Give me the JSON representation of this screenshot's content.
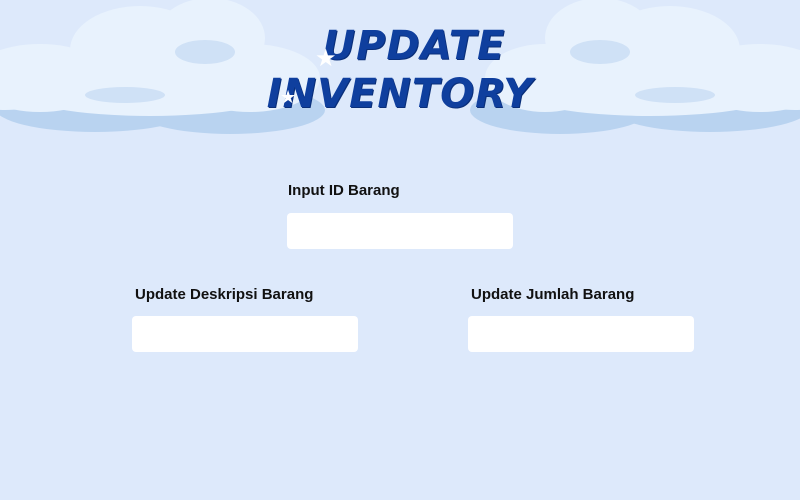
{
  "header": {
    "title_line1": "UPDATE",
    "title_line2": "INVENTORY"
  },
  "form": {
    "id_field": {
      "label": "Input ID Barang",
      "value": "",
      "placeholder": ""
    },
    "description_field": {
      "label": "Update Deskripsi Barang",
      "value": "",
      "placeholder": ""
    },
    "quantity_field": {
      "label": "Update Jumlah Barang",
      "value": "",
      "placeholder": ""
    }
  },
  "colors": {
    "background": "#dde9fb",
    "cloud_light": "#e8f2fd",
    "cloud_shadow": "#b9d3f0",
    "title": "#0f3f9e",
    "input_background": "#ffffff",
    "label_text": "#111111"
  },
  "icons": [
    "cloud-icon",
    "star-icon"
  ]
}
